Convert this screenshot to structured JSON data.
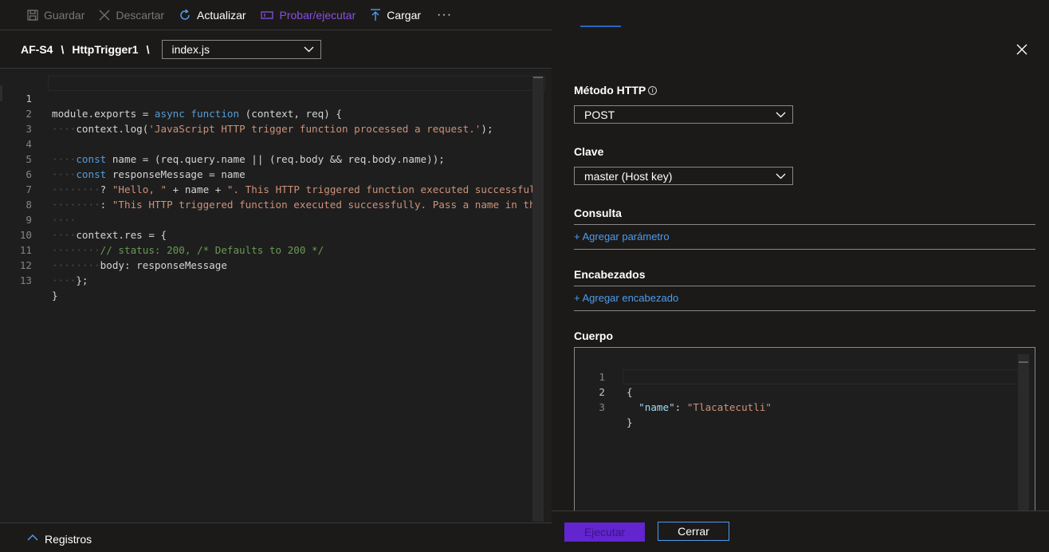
{
  "toolbar": {
    "save_label": "Guardar",
    "discard_label": "Descartar",
    "refresh_label": "Actualizar",
    "test_run_label": "Probar/ejecutar",
    "upload_label": "Cargar",
    "more_label": "···"
  },
  "breadcrumb": {
    "app": "AF-S4",
    "function": "HttpTrigger1",
    "separator": "\\",
    "file_selected": "index.js"
  },
  "editor": {
    "lines": [
      {
        "n": "1"
      },
      {
        "n": "2"
      },
      {
        "n": "3"
      },
      {
        "n": "4"
      },
      {
        "n": "5"
      },
      {
        "n": "6"
      },
      {
        "n": "7"
      },
      {
        "n": "8"
      },
      {
        "n": "9"
      },
      {
        "n": "10"
      },
      {
        "n": "11"
      },
      {
        "n": "12"
      },
      {
        "n": "13"
      }
    ],
    "t": {
      "l1_a": "module.exports = ",
      "l1_kw1": "async",
      "l1_kw2": "function",
      "l1_b": " (context, req) {",
      "l2_a": "context.log(",
      "l2_str": "'JavaScript HTTP trigger function processed a request.'",
      "l2_b": ");",
      "l4_kw": "const",
      "l4_a": " name = (req.query.name || (req.body && req.body.name));",
      "l5_kw": "const",
      "l5_a": " responseMessage = name",
      "l6_a": "? ",
      "l6_s1": "\"Hello, \"",
      "l6_b": " + name + ",
      "l6_s2": "\". This HTTP triggered function executed successful",
      "l7_a": ": ",
      "l7_s": "\"This HTTP triggered function executed successfully. Pass a name in th",
      "l9_a": "context.res = {",
      "l10_c": "// status: 200, /* Defaults to 200 */",
      "l11_a": "body: responseMessage",
      "l12_a": "};",
      "l13_a": "}"
    }
  },
  "logs": {
    "label": "Registros"
  },
  "panel": {
    "method_label": "Método HTTP",
    "method_value": "POST",
    "key_label": "Clave",
    "key_value": "master (Host key)",
    "query_label": "Consulta",
    "query_add": "+ Agregar parámetro",
    "headers_label": "Encabezados",
    "headers_add": "+ Agregar encabezado",
    "body_label": "Cuerpo",
    "body_lines": [
      "1",
      "2",
      "3"
    ],
    "body_t": {
      "b1": "{",
      "b2_key": "\"name\"",
      "b2_sep": ": ",
      "b2_val": "\"Tlacatecutli\"",
      "b3": "}"
    },
    "run_label": "Ejecutar",
    "close_label": "Cerrar"
  },
  "colors": {
    "accent_purple": "#6225d0",
    "link_blue": "#4f9bea",
    "background": "#1b1a19",
    "editor_bg": "#1e1e1e"
  }
}
